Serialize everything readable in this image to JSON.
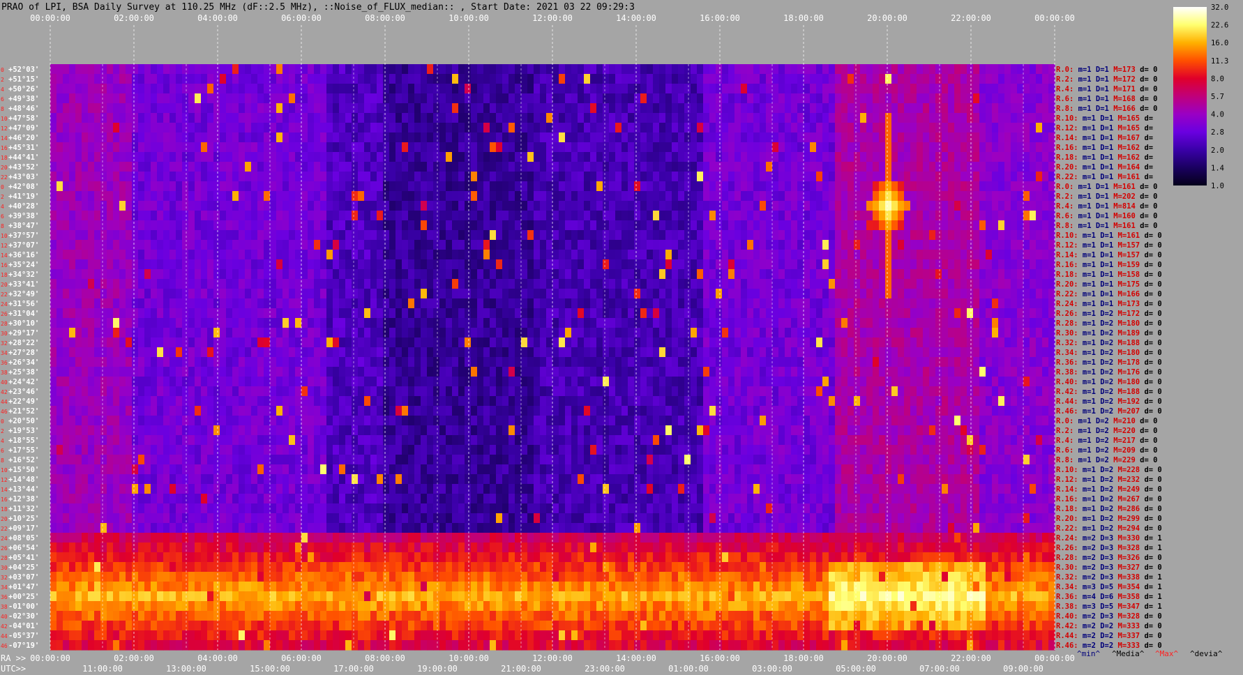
{
  "title": "PRAO of LPI, BSA Daily Survey at 110.25 MHz (dF::2.5 MHz), ::Noise_of_FLUX_median:: , Start Date: 2021 03 22 09:29:3",
  "chart_data": {
    "type": "heatmap",
    "title": "PRAO of LPI, BSA Daily Survey at 110.25 MHz (dF::2.5 MHz), ::Noise_of_FLUX_median:: , Start Date: 2021 03 22 09:29:3",
    "ra_axis_label": "RA >>",
    "utc_axis_label": "UTC>>",
    "top_ticks": [
      "00:00:00",
      "02:00:00",
      "04:00:00",
      "06:00:00",
      "08:00:00",
      "10:00:00",
      "12:00:00",
      "14:00:00",
      "16:00:00",
      "18:00:00",
      "20:00:00",
      "22:00:00",
      "00:00:00"
    ],
    "ra_ticks": [
      "00:00:00",
      "02:00:00",
      "04:00:00",
      "06:00:00",
      "08:00:00",
      "10:00:00",
      "12:00:00",
      "14:00:00",
      "16:00:00",
      "18:00:00",
      "20:00:00",
      "22:00:00",
      "00:00:00"
    ],
    "utc_ticks": [
      "11:00:00",
      "13:00:00",
      "15:00:00",
      "17:00:00",
      "19:00:00",
      "21:00:00",
      "23:00:00",
      "01:00:00",
      "03:00:00",
      "05:00:00",
      "07:00:00",
      "09:00:00"
    ],
    "declinations": [
      "+52°03'",
      "+51°15'",
      "+50°26'",
      "+49°38'",
      "+48°46'",
      "+47°58'",
      "+47°09'",
      "+46°20'",
      "+45°31'",
      "+44°41'",
      "+43°52'",
      "+43°03'",
      "+42°08'",
      "+41°19'",
      "+40°28'",
      "+39°38'",
      "+38°47'",
      "+37°57'",
      "+37°07'",
      "+36°16'",
      "+35°24'",
      "+34°32'",
      "+33°41'",
      "+32°49'",
      "+31°56'",
      "+31°04'",
      "+30°10'",
      "+29°17'",
      "+28°22'",
      "+27°28'",
      "+26°34'",
      "+25°38'",
      "+24°42'",
      "+23°46'",
      "+22°49'",
      "+21°52'",
      "+20°50'",
      "+19°53'",
      "+18°55'",
      "+17°55'",
      "+16°52'",
      "+15°50'",
      "+14°48'",
      "+13°44'",
      "+12°38'",
      "+11°32'",
      "+10°25'",
      "+09°17'",
      "+08°05'",
      "+06°54'",
      "+05°41'",
      "+04°25'",
      "+03°07'",
      "+01°47'",
      "+00°25'",
      "-01°00'",
      "-02°30'",
      "-04°01'",
      "-05°37'",
      "-07°19'"
    ],
    "beam_index": [
      "0",
      "2",
      "4",
      "6",
      "8",
      "10",
      "12",
      "14",
      "16",
      "18",
      "20",
      "22",
      "0",
      "2",
      "4",
      "6",
      "8",
      "10",
      "12",
      "14",
      "16",
      "18",
      "20",
      "22",
      "24",
      "26",
      "28",
      "30",
      "32",
      "34",
      "36",
      "38",
      "40",
      "42",
      "44",
      "46",
      "0",
      "2",
      "4",
      "6",
      "8",
      "10",
      "12",
      "14",
      "16",
      "18",
      "20",
      "22",
      "24",
      "26",
      "28",
      "30",
      "32",
      "34",
      "36",
      "38",
      "40",
      "42",
      "44",
      "46"
    ],
    "rows": [
      {
        "r": "R.0:",
        "m": "m=1",
        "d": "D=1",
        "M": "M=173",
        "e": "d= 0"
      },
      {
        "r": "R.2:",
        "m": "m=1",
        "d": "D=1",
        "M": "M=172",
        "e": "d= 0"
      },
      {
        "r": "R.4:",
        "m": "m=1",
        "d": "D=1",
        "M": "M=171",
        "e": "d= 0"
      },
      {
        "r": "R.6:",
        "m": "m=1",
        "d": "D=1",
        "M": "M=168",
        "e": "d= 0"
      },
      {
        "r": "R.8:",
        "m": "m=1",
        "d": "D=1",
        "M": "M=166",
        "e": "d= 0"
      },
      {
        "r": "R.10:",
        "m": "m=1",
        "d": "D=1",
        "M": "M=165",
        "e": "d="
      },
      {
        "r": "R.12:",
        "m": "m=1",
        "d": "D=1",
        "M": "M=165",
        "e": "d="
      },
      {
        "r": "R.14:",
        "m": "m=1",
        "d": "D=1",
        "M": "M=167",
        "e": "d="
      },
      {
        "r": "R.16:",
        "m": "m=1",
        "d": "D=1",
        "M": "M=162",
        "e": "d="
      },
      {
        "r": "R.18:",
        "m": "m=1",
        "d": "D=1",
        "M": "M=162",
        "e": "d="
      },
      {
        "r": "R.20:",
        "m": "m=1",
        "d": "D=1",
        "M": "M=164",
        "e": "d="
      },
      {
        "r": "R.22:",
        "m": "m=1",
        "d": "D=1",
        "M": "M=161",
        "e": "d="
      },
      {
        "r": "R.0:",
        "m": "m=1",
        "d": "D=1",
        "M": "M=161",
        "e": "d= 0"
      },
      {
        "r": "R.2:",
        "m": "m=1",
        "d": "D=1",
        "M": "M=202",
        "e": "d= 0"
      },
      {
        "r": "R.4:",
        "m": "m=1",
        "d": "D=1",
        "M": "M=814",
        "e": "d= 0"
      },
      {
        "r": "R.6:",
        "m": "m=1",
        "d": "D=1",
        "M": "M=160",
        "e": "d= 0"
      },
      {
        "r": "R.8:",
        "m": "m=1",
        "d": "D=1",
        "M": "M=161",
        "e": "d= 0"
      },
      {
        "r": "R.10:",
        "m": "m=1",
        "d": "D=1",
        "M": "M=161",
        "e": "d= 0"
      },
      {
        "r": "R.12:",
        "m": "m=1",
        "d": "D=1",
        "M": "M=157",
        "e": "d= 0"
      },
      {
        "r": "R.14:",
        "m": "m=1",
        "d": "D=1",
        "M": "M=157",
        "e": "d= 0"
      },
      {
        "r": "R.16:",
        "m": "m=1",
        "d": "D=1",
        "M": "M=159",
        "e": "d= 0"
      },
      {
        "r": "R.18:",
        "m": "m=1",
        "d": "D=1",
        "M": "M=158",
        "e": "d= 0"
      },
      {
        "r": "R.20:",
        "m": "m=1",
        "d": "D=1",
        "M": "M=175",
        "e": "d= 0"
      },
      {
        "r": "R.22:",
        "m": "m=1",
        "d": "D=1",
        "M": "M=166",
        "e": "d= 0"
      },
      {
        "r": "R.24:",
        "m": "m=1",
        "d": "D=1",
        "M": "M=173",
        "e": "d= 0"
      },
      {
        "r": "R.26:",
        "m": "m=1",
        "d": "D=2",
        "M": "M=172",
        "e": "d= 0"
      },
      {
        "r": "R.28:",
        "m": "m=1",
        "d": "D=2",
        "M": "M=180",
        "e": "d= 0"
      },
      {
        "r": "R.30:",
        "m": "m=1",
        "d": "D=2",
        "M": "M=189",
        "e": "d= 0"
      },
      {
        "r": "R.32:",
        "m": "m=1",
        "d": "D=2",
        "M": "M=188",
        "e": "d= 0"
      },
      {
        "r": "R.34:",
        "m": "m=1",
        "d": "D=2",
        "M": "M=180",
        "e": "d= 0"
      },
      {
        "r": "R.36:",
        "m": "m=1",
        "d": "D=2",
        "M": "M=178",
        "e": "d= 0"
      },
      {
        "r": "R.38:",
        "m": "m=1",
        "d": "D=2",
        "M": "M=176",
        "e": "d= 0"
      },
      {
        "r": "R.40:",
        "m": "m=1",
        "d": "D=2",
        "M": "M=180",
        "e": "d= 0"
      },
      {
        "r": "R.42:",
        "m": "m=1",
        "d": "D=2",
        "M": "M=188",
        "e": "d= 0"
      },
      {
        "r": "R.44:",
        "m": "m=1",
        "d": "D=2",
        "M": "M=192",
        "e": "d= 0"
      },
      {
        "r": "R.46:",
        "m": "m=1",
        "d": "D=2",
        "M": "M=207",
        "e": "d= 0"
      },
      {
        "r": "R.0:",
        "m": "m=1",
        "d": "D=2",
        "M": "M=210",
        "e": "d= 0"
      },
      {
        "r": "R.2:",
        "m": "m=1",
        "d": "D=2",
        "M": "M=220",
        "e": "d= 0"
      },
      {
        "r": "R.4:",
        "m": "m=1",
        "d": "D=2",
        "M": "M=217",
        "e": "d= 0"
      },
      {
        "r": "R.6:",
        "m": "m=1",
        "d": "D=2",
        "M": "M=209",
        "e": "d= 0"
      },
      {
        "r": "R.8:",
        "m": "m=1",
        "d": "D=2",
        "M": "M=229",
        "e": "d= 0"
      },
      {
        "r": "R.10:",
        "m": "m=1",
        "d": "D=2",
        "M": "M=228",
        "e": "d= 0"
      },
      {
        "r": "R.12:",
        "m": "m=1",
        "d": "D=2",
        "M": "M=232",
        "e": "d= 0"
      },
      {
        "r": "R.14:",
        "m": "m=1",
        "d": "D=2",
        "M": "M=249",
        "e": "d= 0"
      },
      {
        "r": "R.16:",
        "m": "m=1",
        "d": "D=2",
        "M": "M=267",
        "e": "d= 0"
      },
      {
        "r": "R.18:",
        "m": "m=1",
        "d": "D=2",
        "M": "M=286",
        "e": "d= 0"
      },
      {
        "r": "R.20:",
        "m": "m=1",
        "d": "D=2",
        "M": "M=299",
        "e": "d= 0"
      },
      {
        "r": "R.22:",
        "m": "m=1",
        "d": "D=2",
        "M": "M=294",
        "e": "d= 0"
      },
      {
        "r": "R.24:",
        "m": "m=2",
        "d": "D=3",
        "M": "M=330",
        "e": "d= 1"
      },
      {
        "r": "R.26:",
        "m": "m=2",
        "d": "D=3",
        "M": "M=328",
        "e": "d= 1"
      },
      {
        "r": "R.28:",
        "m": "m=2",
        "d": "D=3",
        "M": "M=326",
        "e": "d= 0"
      },
      {
        "r": "R.30:",
        "m": "m=2",
        "d": "D=3",
        "M": "M=327",
        "e": "d= 0"
      },
      {
        "r": "R.32:",
        "m": "m=2",
        "d": "D=3",
        "M": "M=338",
        "e": "d= 1"
      },
      {
        "r": "R.34:",
        "m": "m=3",
        "d": "D=5",
        "M": "M=354",
        "e": "d= 1"
      },
      {
        "r": "R.36:",
        "m": "m=4",
        "d": "D=6",
        "M": "M=358",
        "e": "d= 1"
      },
      {
        "r": "R.38:",
        "m": "m=3",
        "d": "D=5",
        "M": "M=347",
        "e": "d= 1"
      },
      {
        "r": "R.40:",
        "m": "m=2",
        "d": "D=3",
        "M": "M=328",
        "e": "d= 0"
      },
      {
        "r": "R.42:",
        "m": "m=2",
        "d": "D=2",
        "M": "M=333",
        "e": "d= 0"
      },
      {
        "r": "R.44:",
        "m": "m=2",
        "d": "D=2",
        "M": "M=337",
        "e": "d= 0"
      },
      {
        "r": "R.46:",
        "m": "m=2",
        "d": "D=2",
        "M": "M=333",
        "e": "d= 0"
      }
    ],
    "footer_legend": [
      "^min^",
      "^Media^",
      "^Max^",
      "^devia^"
    ],
    "colorbar": {
      "ticks": [
        "32.0",
        "22.6",
        "16.0",
        "11.3",
        "8.0",
        "5.7",
        "4.0",
        "2.8",
        "2.0",
        "1.4",
        "1.0"
      ],
      "colors": [
        "#ffffff",
        "#ffff70",
        "#ffb000",
        "#ff5000",
        "#e0002a",
        "#c0007a",
        "#9a00c4",
        "#6a00e0",
        "#3a00a8",
        "#1a0060",
        "#05001a"
      ]
    },
    "features": [
      {
        "kind": "band",
        "dec_from": "+08°05'",
        "dec_to": "-07°19'",
        "desc": "Galactic-plane emission band"
      },
      {
        "kind": "source",
        "ra": "20:00:00",
        "dec": "+40°28'",
        "desc": "Bright source Cygnus A"
      }
    ]
  },
  "colors": {
    "background": "#a5a5a5",
    "title_text": "#000000",
    "axis_text": "#ffffff",
    "right_red": "#d40000",
    "right_blue": "#00007a",
    "label_red": "#ff2020"
  }
}
